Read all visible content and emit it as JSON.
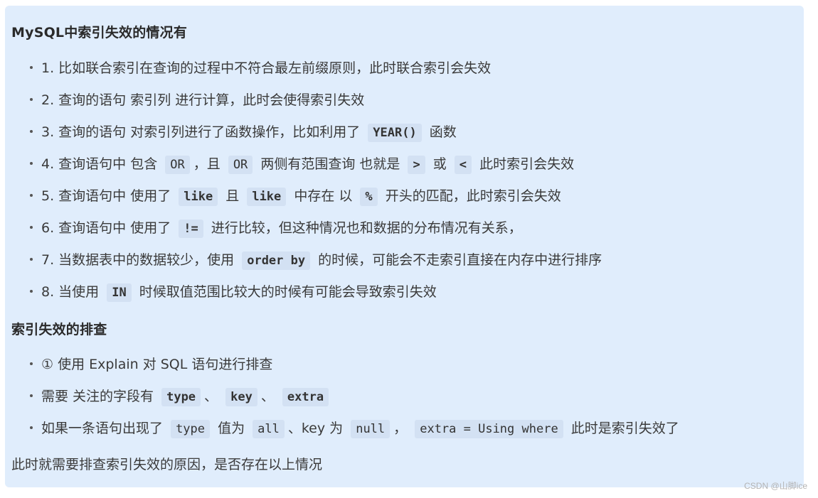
{
  "section1": {
    "title": "MySQL中索引失效的情况有",
    "items": [
      {
        "t1": "1. 比如联合索引在查询的过程中不符合最左前缀原则，此时联合索引会失效"
      },
      {
        "t1": "2. 查询的语句 索引列 进行计算，此时会使得索引失效"
      },
      {
        "t1": "3. 查询的语句 对索引列进行了函数操作，比如利用了",
        "c1": "YEAR()",
        "t2": "函数"
      },
      {
        "t1": "4. 查询语句中 包含",
        "c1": "OR",
        "t2": "，且",
        "c2": "OR",
        "t3": "两侧有范围查询 也就是",
        "c3": ">",
        "t4": "或",
        "c4": "<",
        "t5": "此时索引会失效"
      },
      {
        "t1": "5. 查询语句中 使用了",
        "c1": "like",
        "t2": "且",
        "c2": "like",
        "t3": "中存在 以",
        "c3": "%",
        "t4": "开头的匹配，此时索引会失效"
      },
      {
        "t1": "6. 查询语句中 使用了",
        "c1": "!=",
        "t2": "进行比较，但这种情况也和数据的分布情况有关系，"
      },
      {
        "t1": "7. 当数据表中的数据较少，使用",
        "c1": "order by",
        "t2": "的时候，可能会不走索引直接在内存中进行排序"
      },
      {
        "t1": "8. 当使用",
        "c1": "IN",
        "t2": "时候取值范围比较大的时候有可能会导致索引失效"
      }
    ]
  },
  "section2": {
    "title": "索引失效的排查",
    "items": [
      {
        "t1": "① 使用 Explain 对 SQL 语句进行排查"
      },
      {
        "t1": "需要 关注的字段有",
        "c1": "type",
        "t2": "、",
        "c2": "key",
        "t3": "、",
        "c3": "extra"
      },
      {
        "t1": "如果一条语句出现了",
        "c1": "type",
        "t2": "值为",
        "c2": "all",
        "t3": "、key 为",
        "c3": "null",
        "t4": "，",
        "c4": "extra = Using where",
        "t5": "此时是索引失效了"
      }
    ]
  },
  "footer_text": "此时就需要排查索引失效的原因，是否存在以上情况",
  "watermark": "CSDN @山脚ice"
}
